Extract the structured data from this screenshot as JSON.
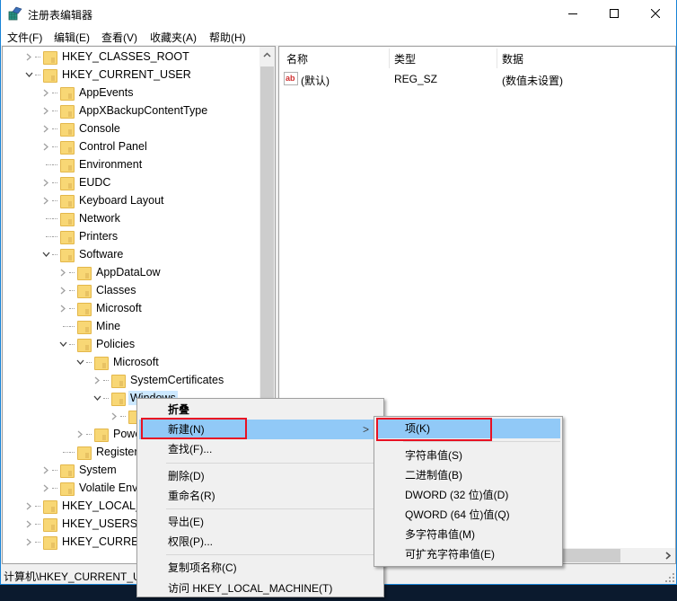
{
  "window": {
    "title": "注册表编辑器",
    "icon": "regedit-icon",
    "controls": {
      "minimize": "minimize-icon",
      "maximize": "maximize-icon",
      "close": "close-icon"
    }
  },
  "menubar": [
    "文件(F)",
    "编辑(E)",
    "查看(V)",
    "收藏夹(A)",
    "帮助(H)"
  ],
  "tree": [
    {
      "label": "HKEY_CLASSES_ROOT",
      "level": 0,
      "expander": "collapsed"
    },
    {
      "label": "HKEY_CURRENT_USER",
      "level": 0,
      "expander": "expanded"
    },
    {
      "label": "AppEvents",
      "level": 1,
      "expander": "collapsed"
    },
    {
      "label": "AppXBackupContentType",
      "level": 1,
      "expander": "collapsed"
    },
    {
      "label": "Console",
      "level": 1,
      "expander": "collapsed"
    },
    {
      "label": "Control Panel",
      "level": 1,
      "expander": "collapsed"
    },
    {
      "label": "Environment",
      "level": 1,
      "expander": "none"
    },
    {
      "label": "EUDC",
      "level": 1,
      "expander": "collapsed"
    },
    {
      "label": "Keyboard Layout",
      "level": 1,
      "expander": "collapsed"
    },
    {
      "label": "Network",
      "level": 1,
      "expander": "none"
    },
    {
      "label": "Printers",
      "level": 1,
      "expander": "none"
    },
    {
      "label": "Software",
      "level": 1,
      "expander": "expanded"
    },
    {
      "label": "AppDataLow",
      "level": 2,
      "expander": "collapsed"
    },
    {
      "label": "Classes",
      "level": 2,
      "expander": "collapsed"
    },
    {
      "label": "Microsoft",
      "level": 2,
      "expander": "collapsed"
    },
    {
      "label": "Mine",
      "level": 2,
      "expander": "none"
    },
    {
      "label": "Policies",
      "level": 2,
      "expander": "expanded"
    },
    {
      "label": "Microsoft",
      "level": 3,
      "expander": "expanded"
    },
    {
      "label": "SystemCertificates",
      "level": 4,
      "expander": "collapsed"
    },
    {
      "label": "Windows",
      "level": 4,
      "expander": "expanded",
      "selected": true
    },
    {
      "label": "",
      "level": 5,
      "expander": "collapsed"
    },
    {
      "label": "Powe",
      "level": 3,
      "expander": "collapsed"
    },
    {
      "label": "Registere",
      "level": 2,
      "expander": "none"
    },
    {
      "label": "System",
      "level": 1,
      "expander": "collapsed"
    },
    {
      "label": "Volatile Envi",
      "level": 1,
      "expander": "collapsed"
    },
    {
      "label": "HKEY_LOCAL_M",
      "level": 0,
      "expander": "collapsed"
    },
    {
      "label": "HKEY_USERS",
      "level": 0,
      "expander": "collapsed"
    },
    {
      "label": "HKEY_CURRENT",
      "level": 0,
      "expander": "collapsed"
    }
  ],
  "list": {
    "columns": [
      "名称",
      "类型",
      "数据"
    ],
    "rows": [
      {
        "icon": "string-value-icon",
        "icon_text": "ab",
        "name": "(默认)",
        "type": "REG_SZ",
        "data": "(数值未设置)"
      }
    ]
  },
  "status": {
    "path": "计算机\\HKEY_CURRENT_US"
  },
  "context_menu": {
    "items": [
      {
        "label": "折叠",
        "bold": true
      },
      {
        "label": "新建(N)",
        "highlighted": true,
        "submenu": true
      },
      {
        "label": "查找(F)..."
      },
      {
        "separator": true
      },
      {
        "label": "删除(D)"
      },
      {
        "label": "重命名(R)"
      },
      {
        "separator": true
      },
      {
        "label": "导出(E)"
      },
      {
        "label": "权限(P)..."
      },
      {
        "separator": true
      },
      {
        "label": "复制项名称(C)"
      },
      {
        "label": "访问 HKEY_LOCAL_MACHINE(T)"
      }
    ],
    "submenu_arrow": ">"
  },
  "submenu": {
    "items": [
      {
        "label": "项(K)",
        "highlighted": true
      },
      {
        "separator": true
      },
      {
        "label": "字符串值(S)"
      },
      {
        "label": "二进制值(B)"
      },
      {
        "label": "DWORD (32 位)值(D)"
      },
      {
        "label": "QWORD (64 位)值(Q)"
      },
      {
        "label": "多字符串值(M)"
      },
      {
        "label": "可扩充字符串值(E)"
      }
    ]
  },
  "colors": {
    "highlight": "#91c9f7",
    "selection": "#cce8ff",
    "annotation_box": "#e81123",
    "window_border": "#1883d7"
  }
}
